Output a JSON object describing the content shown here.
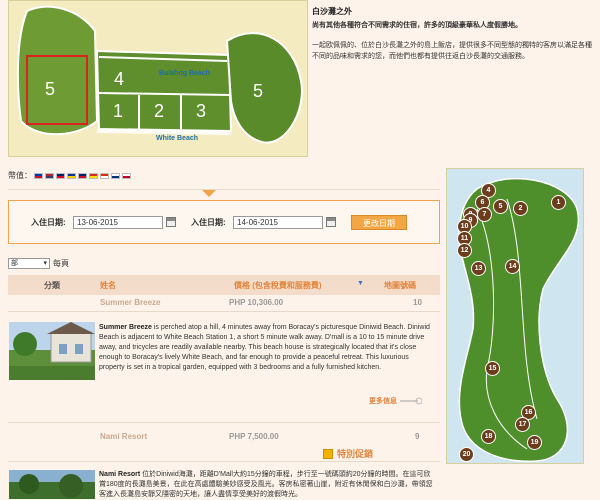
{
  "map": {
    "beach_top": "Bulabog Beach",
    "beach_bottom": "White Beach",
    "zones": [
      "5",
      "4",
      "1",
      "2",
      "3",
      "5"
    ]
  },
  "intro": {
    "title": "白沙灘之外",
    "subtitle": "尚有其他各種符合不同需求的住宿，許多的頂級豪華私人度假勝地。",
    "body": "一起欧佩佩的、位於白沙長灘之外的島上飯店，提供很多不同型態的獨特的客房以滿足各種不同的品味和需求的您，而他們也都有提供往返白沙長灘的交通服務。"
  },
  "currency": {
    "label": "幣值：",
    "flags": [
      {
        "name": "philippines-flag",
        "c1": "#0038a8",
        "c2": "#ce1126"
      },
      {
        "name": "usa-flag",
        "c1": "#b22234",
        "c2": "#3c3b6e"
      },
      {
        "name": "australia-flag",
        "c1": "#012169",
        "c2": "#e4002b"
      },
      {
        "name": "eu-flag",
        "c1": "#003399",
        "c2": "#ffcc00"
      },
      {
        "name": "uk-flag",
        "c1": "#012169",
        "c2": "#c8102e"
      },
      {
        "name": "china-flag",
        "c1": "#de2910",
        "c2": "#ffde00"
      },
      {
        "name": "hongkong-flag",
        "c1": "#de2910",
        "c2": "#ffffff"
      },
      {
        "name": "korea-flag",
        "c1": "#ffffff",
        "c2": "#003478"
      },
      {
        "name": "japan-flag",
        "c1": "#ffffff",
        "c2": "#bc002d"
      }
    ]
  },
  "dates": {
    "checkin_label": "入住日期:",
    "checkin_value": "13-06-2015",
    "checkout_label": "入住日期:",
    "checkout_value": "14-06-2015",
    "change_button": "更改日期"
  },
  "paging": {
    "select_value": "部",
    "suffix": "每頁"
  },
  "table": {
    "col_category": "分類",
    "col_name": "姓名",
    "col_price": "價格 (包含稅費和服務費)",
    "col_phone": "地圖號碼",
    "rows": [
      {
        "name": "Summer Breeze",
        "price": "PHP 10,306.00",
        "map_no": "10",
        "desc_name": "Summer Breeze",
        "desc": " is perched atop a hill, 4 minutes away from Boracay's picturesque Diniwid Beach. Diniwid Beach is adjacent to White Beach Station 1, a short 5 minute walk away. D'mall is a 10 to 15 minute drive away, and tricycles are readily available nearby. This beach house is strategically located that it's close enough to Boracay's lively White Beach, and far enough to provide a peaceful retreat. This luxurious property is set in a tropical garden, equipped with 3 bedrooms and a fully furnished kitchen.",
        "more": "更多信息"
      },
      {
        "name": "Nami Resort",
        "price": "PHP 7,500.00",
        "map_no": "9",
        "promo": "特別促銷",
        "desc_name": "Nami Resort",
        "desc": " 位於Diniwid海灘，距離D'Mall大約15分鐘的車程，步行至一號碼頭約20分鐘的時間。在這可欣賞180度的長灘島美景，在此在高處體驗美妙感受及風光。客房私密著山崖，附近有休閒保和白沙灘，帶領您客進入長灘島安靜又隱密的天地，讓人盡情享受美好的渡假時光。"
      }
    ]
  },
  "right_map": {
    "markers": [
      "1",
      "2",
      "4",
      "5",
      "6",
      "7",
      "8",
      "9",
      "10",
      "11",
      "12",
      "13",
      "14",
      "15",
      "16",
      "17",
      "18",
      "19",
      "20"
    ]
  }
}
